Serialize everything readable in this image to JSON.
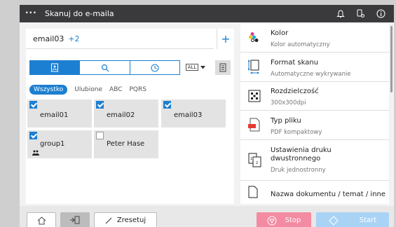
{
  "header": {
    "menu_icon": "ellipsis-icon",
    "title": "Skanuj do e-maila",
    "icons": [
      "bell-icon",
      "hand-settings-icon",
      "info-icon"
    ]
  },
  "destination": {
    "address": "email03",
    "extra_count": "+2",
    "add_label": "+"
  },
  "search_tabs": [
    "address-book-icon",
    "search-icon",
    "history-icon"
  ],
  "all_dropdown": {
    "value": "ALL"
  },
  "filters": [
    "Wszystko",
    "Ulubione",
    "ABC",
    "PQRS"
  ],
  "contacts": [
    {
      "name": "email01",
      "checked": true,
      "group": false
    },
    {
      "name": "email02",
      "checked": true,
      "group": false
    },
    {
      "name": "email03",
      "checked": true,
      "group": false
    },
    {
      "name": "group1",
      "checked": true,
      "group": true
    },
    {
      "name": "Peter Hase",
      "checked": false,
      "group": false
    }
  ],
  "settings": [
    {
      "title": "Kolor",
      "sub": "Kolor automatyczny",
      "icon": "color-dots-icon"
    },
    {
      "title": "Format skanu",
      "sub": "Automatyczne wykrywanie",
      "icon": "scan-size-icon"
    },
    {
      "title": "Rozdzielczość",
      "sub": "300x300dpi",
      "icon": "resolution-icon"
    },
    {
      "title": "Typ pliku",
      "sub": "PDF kompaktowy",
      "icon": "pdf-file-icon"
    },
    {
      "title": "Ustawienia druku dwustronnego",
      "sub": "Druk jednostronny",
      "icon": "duplex-icon"
    },
    {
      "title": "Nazwa dokumentu / temat / inne",
      "sub": "",
      "icon": "document-icon"
    }
  ],
  "footer": {
    "reset_label": "Zresetuj",
    "stop_label": "Stop",
    "start_label": "Start"
  },
  "colors": {
    "accent": "#1d7fd1",
    "stop": "#f38ba2",
    "start": "#a9d3f5",
    "titlebar": "#3a3a3c"
  }
}
